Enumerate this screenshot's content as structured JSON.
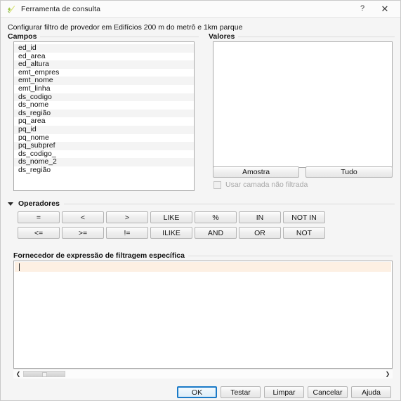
{
  "window": {
    "title": "Ferramenta de consulta",
    "icon": "qgis-icon",
    "help_glyph": "?",
    "close_glyph": "✕"
  },
  "subtitle": "Configurar filtro de provedor em Edifícios 200 m do metrô e 1km parque",
  "campos": {
    "label": "Campos",
    "items": [
      "ed_id",
      "ed_area",
      "ed_altura",
      "emt_empres",
      "emt_nome",
      "emt_linha",
      "ds_codigo",
      "ds_nome",
      "ds_região",
      "pq_area",
      "pq_id",
      "pq_nome",
      "pq_subpref",
      "ds_codigo_",
      "ds_nome_2",
      "ds_região"
    ]
  },
  "valores": {
    "label": "Valores",
    "items": [],
    "sample_button": "Amostra",
    "all_button": "Tudo",
    "unfiltered_checkbox": {
      "label": "Usar camada não filtrada",
      "checked": false,
      "enabled": false
    }
  },
  "operadores": {
    "label": "Operadores",
    "expanded": true,
    "collapse_glyph": "▼",
    "rows": [
      [
        "=",
        "<",
        ">",
        "LIKE",
        "%",
        "IN",
        "NOT IN"
      ],
      [
        "<=",
        ">=",
        "!=",
        "ILIKE",
        "AND",
        "OR",
        "NOT"
      ]
    ]
  },
  "expression": {
    "label": "Fornecedor de expressão de filtragem específica",
    "value": "",
    "scrollbar": {
      "left_glyph": "❮",
      "right_glyph": "❯"
    }
  },
  "footer": {
    "buttons": [
      {
        "label": "OK",
        "focused": true
      },
      {
        "label": "Testar",
        "focused": false
      },
      {
        "label": "Limpar",
        "focused": false
      },
      {
        "label": "Cancelar",
        "focused": false
      },
      {
        "label": "Ajuda",
        "focused": false
      }
    ]
  },
  "colors": {
    "accent": "#1a7ac7",
    "dialog_bg": "#f5f5f5",
    "field_bg": "#ffffff",
    "current_line": "#fdf0e3",
    "icon_green": "#93c23e"
  }
}
